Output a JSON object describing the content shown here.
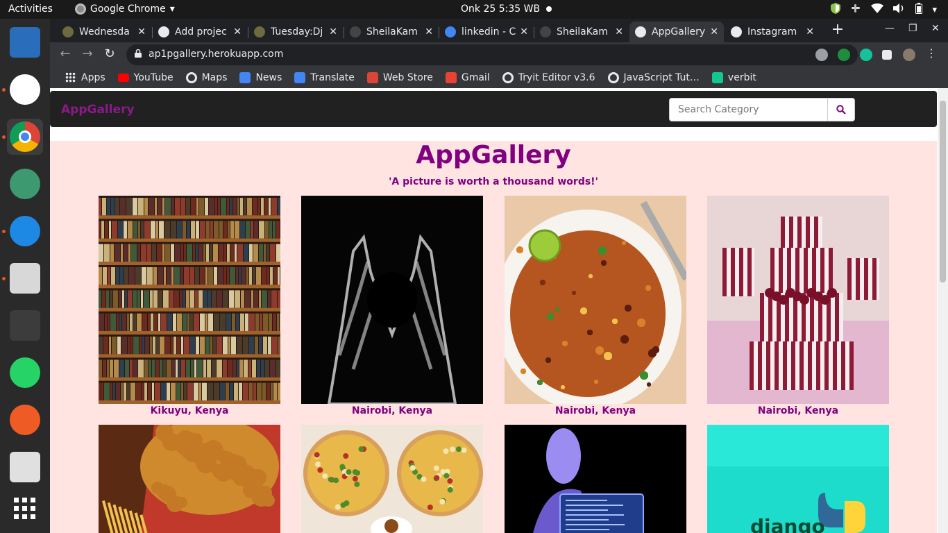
{
  "topbar": {
    "activities": "Activities",
    "app_name": "Google Chrome",
    "app_menu_arrow": "▾",
    "clock": "Onk 25   5:35 WB"
  },
  "dock": {
    "items": [
      {
        "name": "document-viewer",
        "color": "#2a6ebb",
        "running": false
      },
      {
        "name": "slack",
        "color": "#ffffff",
        "running": true
      },
      {
        "name": "google-chrome",
        "color": "#db4437",
        "running": true
      },
      {
        "name": "atom",
        "color": "#3d9970",
        "running": false
      },
      {
        "name": "vs-code",
        "color": "#1e88e5",
        "running": true
      },
      {
        "name": "files",
        "color": "#d8d8d8",
        "running": true
      },
      {
        "name": "terminal",
        "color": "#3c3c3c",
        "running": false
      },
      {
        "name": "whatsapp",
        "color": "#25d366",
        "running": false
      },
      {
        "name": "postman",
        "color": "#ef5b25",
        "running": false
      },
      {
        "name": "reader",
        "color": "#e0e0e0",
        "running": false
      },
      {
        "name": "show-apps",
        "color": "#ffffff",
        "running": false
      }
    ]
  },
  "tabs": [
    {
      "title": "Wednesda",
      "favicon": "plant",
      "active": false
    },
    {
      "title": "Add projec",
      "favicon": "globe",
      "active": false
    },
    {
      "title": "Tuesday:Dj",
      "favicon": "plant",
      "active": false
    },
    {
      "title": "SheilaKam",
      "favicon": "github",
      "active": false
    },
    {
      "title": "linkedin - C",
      "favicon": "google",
      "active": false
    },
    {
      "title": "SheilaKam",
      "favicon": "github",
      "active": false
    },
    {
      "title": "AppGallery",
      "favicon": "globe",
      "active": true
    },
    {
      "title": "Instagram",
      "favicon": "globe",
      "active": false
    }
  ],
  "tab_close": "✕",
  "new_tab": "+",
  "window_controls": {
    "minimize": "—",
    "maximize": "❐",
    "close": "✕"
  },
  "toolbar": {
    "back": "←",
    "forward": "→",
    "reload": "↻",
    "url": "ap1pgallery.herokuapp.com",
    "star": "☆"
  },
  "bookmarks": [
    {
      "label": "Apps",
      "icon": "apps-grid-icon",
      "color": "#e8eaed"
    },
    {
      "label": "YouTube",
      "icon": "youtube-icon",
      "color": "#ff0000"
    },
    {
      "label": "Maps",
      "icon": "globe-icon",
      "color": "#e8eaed"
    },
    {
      "label": "News",
      "icon": "news-icon",
      "color": "#4285f4"
    },
    {
      "label": "Translate",
      "icon": "translate-icon",
      "color": "#4285f4"
    },
    {
      "label": "Web Store",
      "icon": "web-store-icon",
      "color": "#db4437"
    },
    {
      "label": "Gmail",
      "icon": "gmail-icon",
      "color": "#ea4335"
    },
    {
      "label": "Tryit Editor v3.6",
      "icon": "globe-icon",
      "color": "#e8eaed"
    },
    {
      "label": "JavaScript Tut…",
      "icon": "globe-icon",
      "color": "#e8eaed"
    },
    {
      "label": "verbit",
      "icon": "verbit-icon",
      "color": "#12c98b"
    }
  ],
  "site": {
    "brand": "AppGallery",
    "search_placeholder": "Search Category",
    "title": "AppGallery",
    "tagline": "'A picture is worth a thousand words!'",
    "accent": "#800080",
    "background": "#ffe4e1"
  },
  "gallery": [
    {
      "caption": "Kikuyu, Kenya",
      "image": "bookshelf"
    },
    {
      "caption": "Nairobi, Kenya",
      "image": "xray-heart-hands"
    },
    {
      "caption": "Nairobi, Kenya",
      "image": "bean-stew"
    },
    {
      "caption": "Nairobi, Kenya",
      "image": "striped-wedding-cake"
    },
    {
      "caption": "",
      "image": "fried-chicken-bucket"
    },
    {
      "caption": "",
      "image": "pizzas"
    },
    {
      "caption": "",
      "image": "hacker-laptop"
    },
    {
      "caption": "",
      "image": "django-python"
    }
  ]
}
